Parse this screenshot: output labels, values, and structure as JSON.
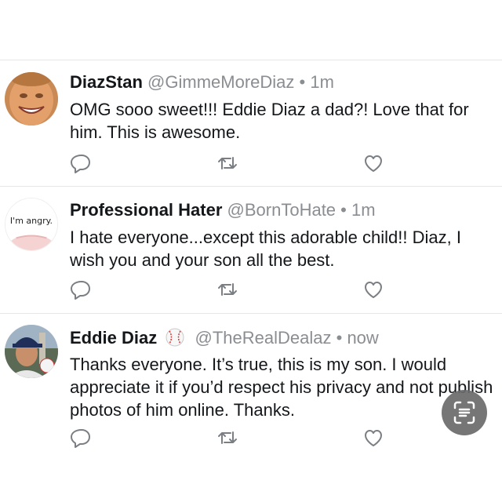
{
  "tweets": [
    {
      "name": "DiazStan",
      "handle": "@GimmeMoreDiaz",
      "dot": "•",
      "time": "1m",
      "text": "OMG sooo sweet!!! Eddie Diaz a dad?! Love that for him. This is awesome."
    },
    {
      "name": "Professional Hater",
      "handle": "@BornToHate",
      "dot": "•",
      "time": "1m",
      "avatar_text": "I'm angry.",
      "text": "I hate everyone...except this adorable child!! Diaz, I wish you and your son all the best."
    },
    {
      "name": "Eddie Diaz",
      "handle": "@TheRealDealaz",
      "dot": "•",
      "time": "now",
      "text": "Thanks everyone. It’s true, this is my son. I would appreciate it if you’d respect his privacy and not publish photos of him online. Thanks."
    }
  ],
  "icons": {
    "reply": "reply-icon",
    "retweet": "retweet-icon",
    "like": "like-icon",
    "scan": "scan-text-icon",
    "badge": "baseball-icon"
  },
  "colors": {
    "text": "#14171a",
    "secondary": "#8a8d91",
    "divider": "#e6e6e6",
    "icon": "#7b7f84"
  }
}
